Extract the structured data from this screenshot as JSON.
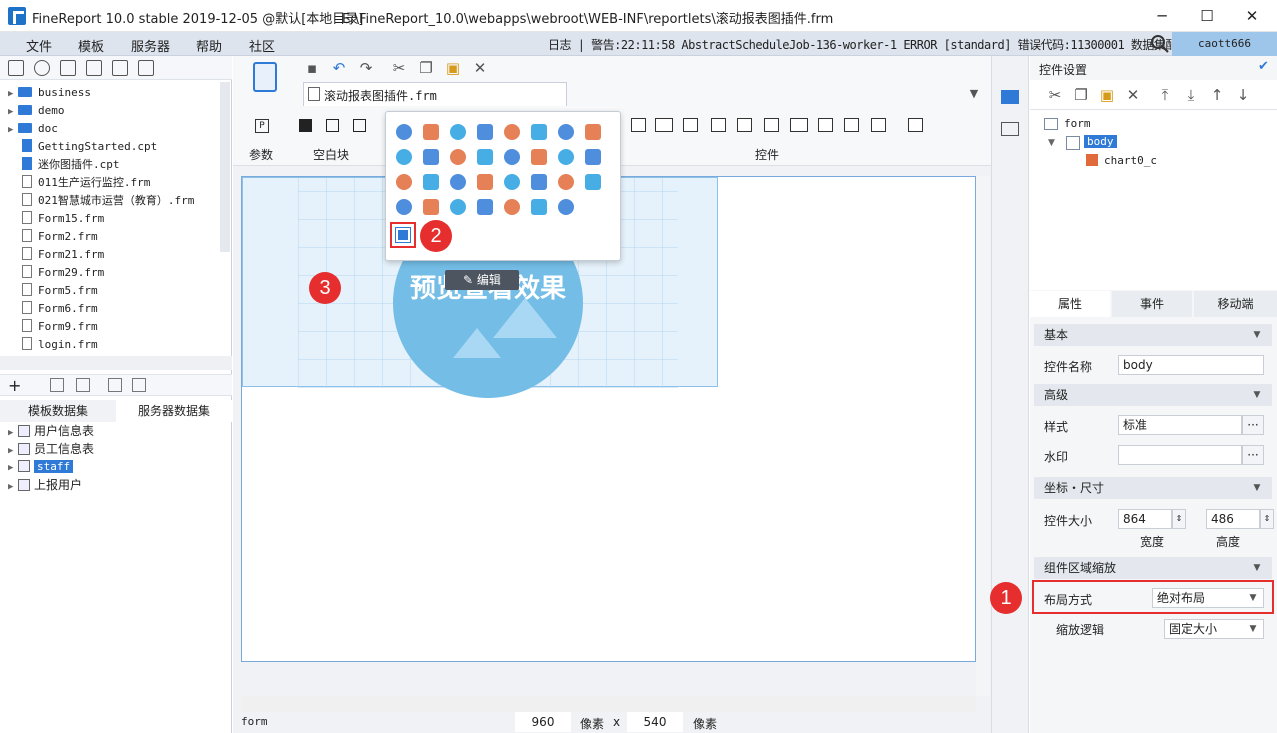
{
  "window": {
    "title": "FineReport 10.0 stable 2019-12-05 @默认[本地目录]",
    "path": "E:\\FineReport_10.0\\webapps\\webroot\\WEB-INF\\reportlets\\滚动报表图插件.frm",
    "controls": {
      "minimize": "─",
      "maximize": "☐",
      "close": "✕"
    }
  },
  "menu": {
    "items": [
      "文件",
      "模板",
      "服务器",
      "帮助",
      "社区"
    ],
    "log": "日志 | 警告:22:11:58 AbstractScheduleJob-136-worker-1 ERROR [standard] 错误代码:11300001 数据集配...",
    "user": "caott666"
  },
  "file_tree": {
    "items": [
      {
        "label": "business",
        "type": "folder"
      },
      {
        "label": "demo",
        "type": "folder"
      },
      {
        "label": "doc",
        "type": "folder"
      },
      {
        "label": "GettingStarted.cpt",
        "type": "cpt"
      },
      {
        "label": "迷你图插件.cpt",
        "type": "cpt"
      },
      {
        "label": "011生产运行监控.frm",
        "type": "frm"
      },
      {
        "label": "021智慧城市运营（教育）.frm",
        "type": "frm"
      },
      {
        "label": "Form15.frm",
        "type": "frm"
      },
      {
        "label": "Form2.frm",
        "type": "frm"
      },
      {
        "label": "Form21.frm",
        "type": "frm"
      },
      {
        "label": "Form29.frm",
        "type": "frm"
      },
      {
        "label": "Form5.frm",
        "type": "frm"
      },
      {
        "label": "Form6.frm",
        "type": "frm"
      },
      {
        "label": "Form9.frm",
        "type": "frm"
      },
      {
        "label": "login.frm",
        "type": "frm"
      }
    ]
  },
  "datasets": {
    "tabs": [
      "模板数据集",
      "服务器数据集"
    ],
    "items": [
      "用户信息表",
      "员工信息表",
      "staff",
      "上报用户"
    ]
  },
  "editor": {
    "doc_tab": "滚动报表图插件.frm",
    "groups": {
      "params": "参数",
      "blank": "空白块",
      "widgets": "控件"
    },
    "chart_text": "预览查看效果",
    "edit_label": "编辑",
    "badges": {
      "one": "1",
      "two": "2",
      "three": "3"
    }
  },
  "status": {
    "name": "form",
    "width": "960",
    "unit1": "像素",
    "x": "x",
    "height": "540",
    "unit2": "像素"
  },
  "right_panel": {
    "title": "控件设置",
    "tree": {
      "root": "form",
      "child": "body",
      "leaf": "chart0_c"
    },
    "tabs": [
      "属性",
      "事件",
      "移动端"
    ],
    "sections": {
      "basic": "基本",
      "advanced": "高级",
      "coords": "坐标・尺寸",
      "scale": "组件区域缩放"
    },
    "fields": {
      "name_label": "控件名称",
      "name_value": "body",
      "style_label": "样式",
      "style_value": "标准",
      "watermark_label": "水印",
      "watermark_value": "",
      "size_label": "控件大小",
      "width_value": "864",
      "height_value": "486",
      "width_caption": "宽度",
      "height_caption": "高度",
      "layout_label": "布局方式",
      "layout_value": "绝对布局",
      "scale_logic_label": "缩放逻辑",
      "scale_logic_value": "固定大小"
    }
  },
  "colors": {
    "accent": "#1e73c8",
    "highlight": "#e62e2e",
    "user_bg": "#9ec5ea"
  }
}
